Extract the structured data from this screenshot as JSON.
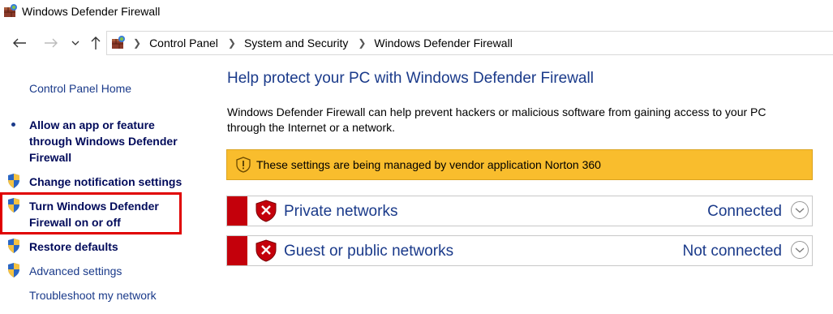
{
  "window": {
    "title": "Windows Defender Firewall"
  },
  "nav": {
    "back_icon": "back-arrow-icon",
    "forward_icon": "forward-arrow-icon",
    "recent_icon": "chevron-down-icon",
    "up_icon": "up-arrow-icon"
  },
  "breadcrumb": [
    "Control Panel",
    "System and Security",
    "Windows Defender Firewall"
  ],
  "sidebar": {
    "home": "Control Panel Home",
    "items": [
      {
        "label_lines": [
          "Allow an app or feature",
          "through Windows Defender",
          "Firewall"
        ],
        "icon": "bullet"
      },
      {
        "label": "Change notification settings",
        "icon": "uac-shield-icon"
      },
      {
        "label_lines": [
          "Turn Windows Defender",
          "Firewall on or off"
        ],
        "icon": "uac-shield-icon",
        "highlighted": true
      },
      {
        "label": "Restore defaults",
        "icon": "uac-shield-icon"
      },
      {
        "label": "Advanced settings",
        "icon": "uac-shield-icon"
      },
      {
        "label": "Troubleshoot my network"
      }
    ]
  },
  "main": {
    "title": "Help protect your PC with Windows Defender Firewall",
    "description": "Windows Defender Firewall can help prevent hackers or malicious software from gaining access to your PC through the Internet or a network.",
    "warning": "These settings are being managed by vendor application Norton 360",
    "networks": [
      {
        "name": "Private networks",
        "status": "Connected"
      },
      {
        "name": "Guest or public networks",
        "status": "Not connected"
      }
    ]
  },
  "colors": {
    "accent": "#1a3a8a",
    "warning_bg": "#f9bd2d",
    "danger": "#c4000b",
    "highlight": "#e00000"
  }
}
